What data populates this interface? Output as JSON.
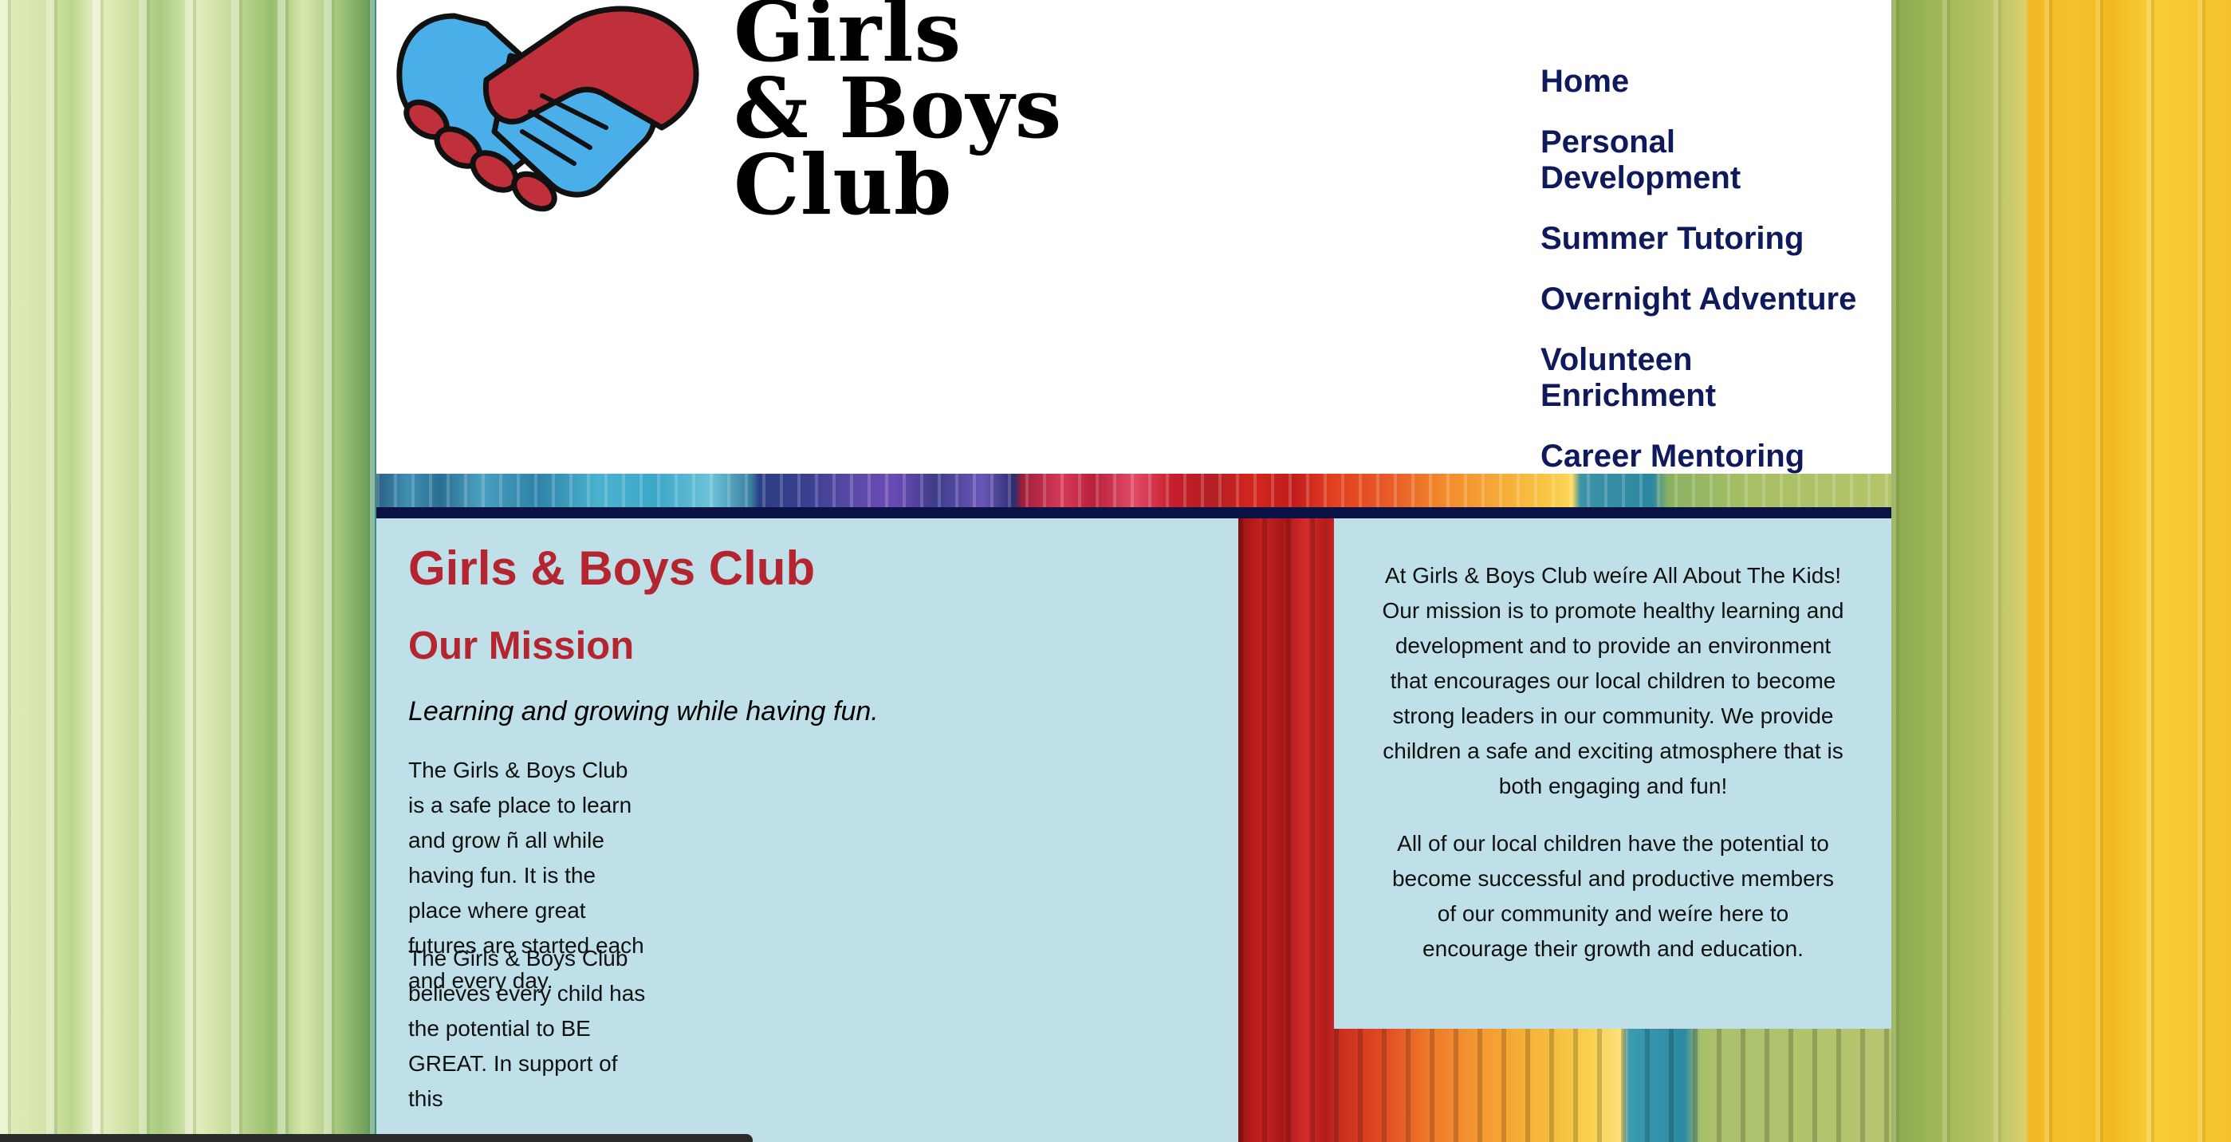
{
  "logo": {
    "lines": [
      "Girls",
      "& Boys",
      "Club"
    ]
  },
  "nav": {
    "items": [
      "Home",
      "Personal Development",
      "Summer Tutoring",
      "Overnight Adventure",
      "Volunteen Enrichment",
      "Career Mentoring"
    ]
  },
  "main": {
    "title": "Girls & Boys Club",
    "subtitle": "Our Mission",
    "tagline": "Learning and growing while having fun.",
    "para1": "The Girls & Boys Club is a safe place to learn and grow ñ all while having fun. It is the place where great futures are started each and every day.",
    "para2": "The Girls & Boys Club believes every child has the potential to BE GREAT. In support of this"
  },
  "sidebar": {
    "para1": "At Girls & Boys Club weíre All About The Kids! Our mission is to promote healthy learning and development and to provide an environment that encourages our local children to become strong leaders in our community. We provide children a safe and exciting atmosphere that is both engaging and fun!",
    "para2": "All of our local children have the potential to become successful and productive members of our community and weíre here to encourage their growth and education."
  },
  "colors": {
    "nav_text": "#0f1a5c",
    "heading_red": "#b5252f",
    "content_bg": "#bfe0e8",
    "navy_bar": "#0b1245",
    "logo_blue": "#4aaee8",
    "logo_red": "#c0303a"
  }
}
